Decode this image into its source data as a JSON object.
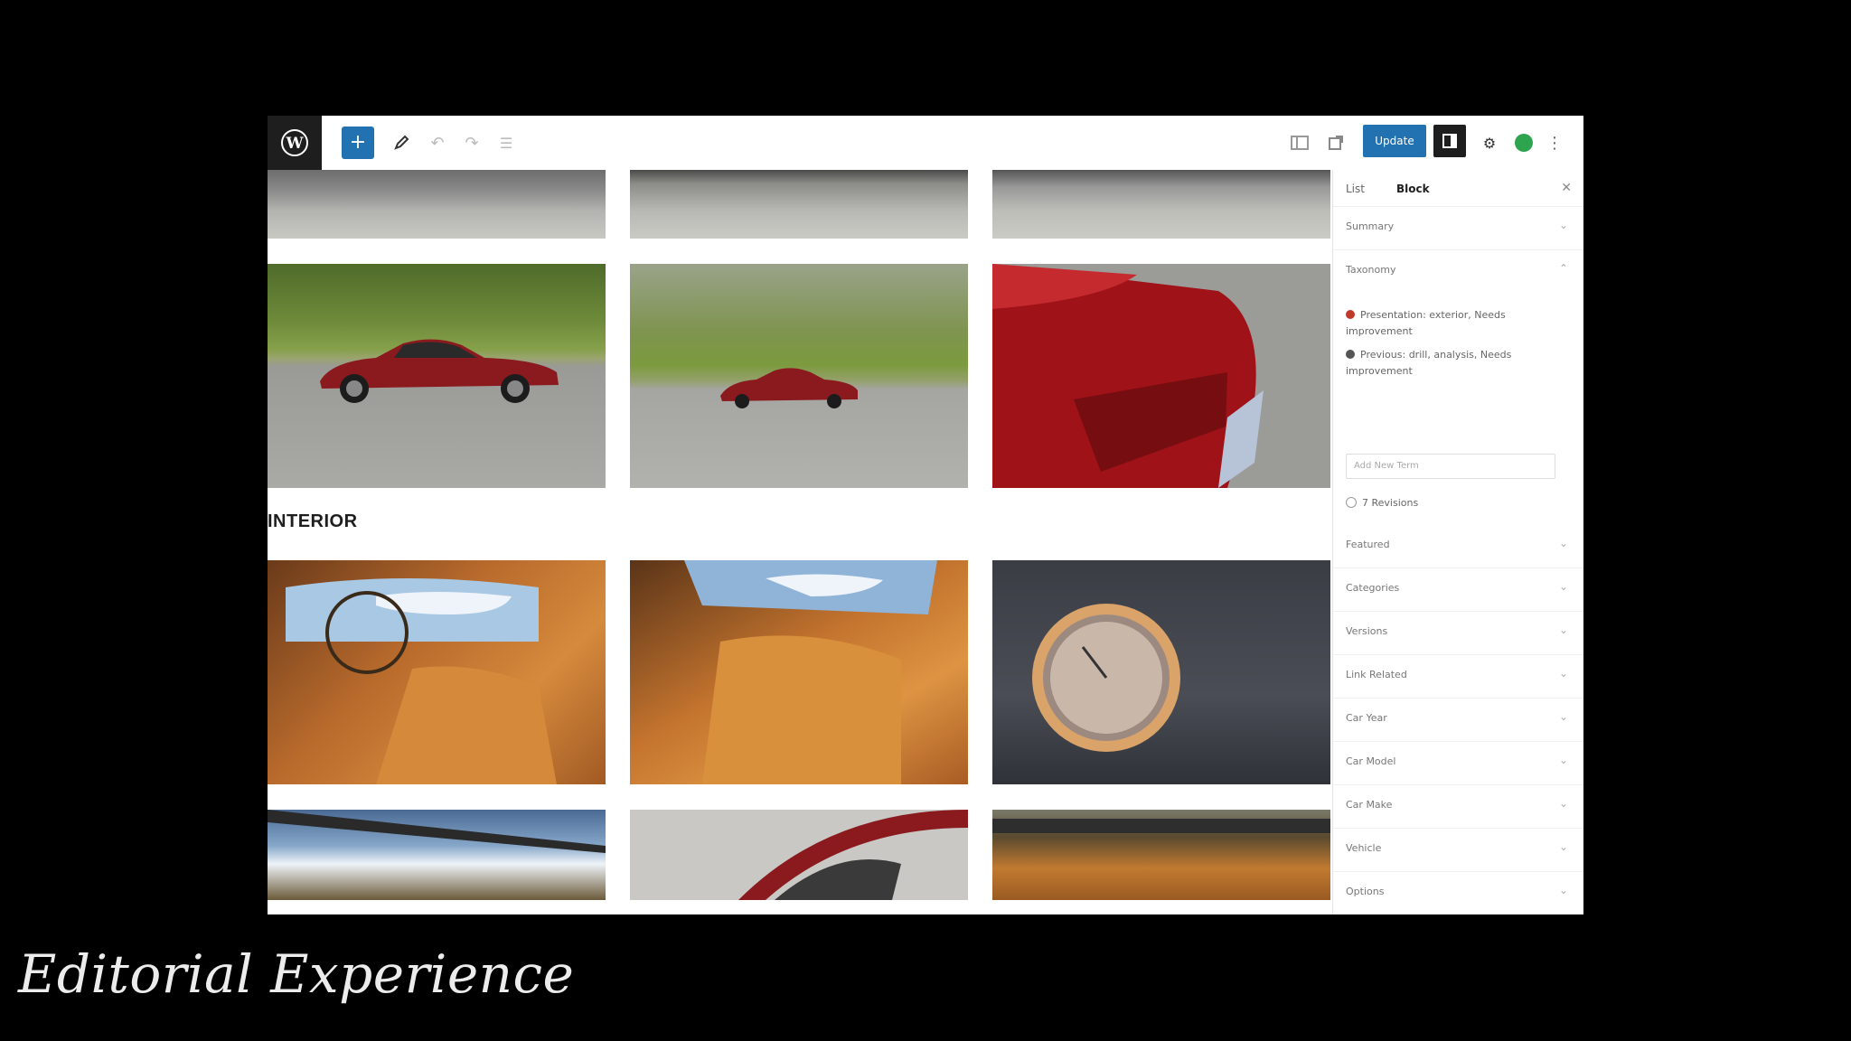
{
  "toolbar": {
    "update_label": "Update"
  },
  "canvas": {
    "section_heading": "INTERIOR"
  },
  "sidebar": {
    "tabs": [
      "List",
      "Block"
    ],
    "panels_top": [
      "Summary",
      "Taxonomy"
    ],
    "terms": [
      {
        "label": "Presentation: exterior, Needs improvement",
        "color": "#c0392b"
      },
      {
        "label": "Previous: drill, analysis, Needs improvement",
        "color": "#555555"
      }
    ],
    "term_input_placeholder": "Add New Term",
    "revisions": "7 Revisions",
    "panels_bottom": [
      "Featured",
      "Categories",
      "Versions",
      "Link Related",
      "Car Year",
      "Car Model",
      "Car Make",
      "Vehicle",
      "Options"
    ]
  },
  "caption": "Editorial Experience",
  "colors": {
    "accent": "#2271b1",
    "dark": "#1e1e1e",
    "background": "#000000"
  }
}
